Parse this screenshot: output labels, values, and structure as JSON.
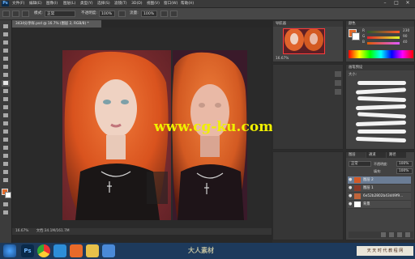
{
  "title_bar": {
    "app_logo": "Ps",
    "menu": [
      "文件(F)",
      "编辑(E)",
      "图像(I)",
      "图层(L)",
      "类型(Y)",
      "选择(S)",
      "滤镜(T)",
      "3D(D)",
      "视图(V)",
      "窗口(W)",
      "帮助(H)"
    ],
    "window_controls": {
      "minimize": "–",
      "maximize": "□",
      "close": "✕"
    }
  },
  "options_bar": {
    "mode_label": "模式:",
    "mode_value": "正常",
    "opacity_label": "不透明度:",
    "opacity_value": "100%",
    "flow_label": "流量:",
    "flow_value": "100%"
  },
  "document": {
    "tab_label": "3434分享样.psd @ 16.7% (图层 2, RGB/8) *",
    "watermark_text": "www.cg-ku.com",
    "status_zoom": "16.67%",
    "status_doc": "文档:34.1M/161.7M"
  },
  "navigator": {
    "zoom": "16.67%"
  },
  "color_panel": {
    "sliders": [
      {
        "label": "R",
        "value": "230"
      },
      {
        "label": "G",
        "value": "90"
      },
      {
        "label": "B",
        "value": "40"
      }
    ]
  },
  "brush_panel": {
    "tab_label": "画笔预设",
    "size_label": "大小:",
    "size_value": ""
  },
  "layers_panel": {
    "tabs": [
      "图层",
      "通道",
      "路径"
    ],
    "blend_mode": "正常",
    "opacity_label": "不透明度:",
    "opacity_value": "100%",
    "fill_label": "填充:",
    "fill_value": "100%",
    "layers": [
      {
        "name": "图层 2",
        "selected": true
      },
      {
        "name": "图层 1",
        "selected": false
      },
      {
        "name": "6e52b2802b43d49f9...",
        "selected": false
      },
      {
        "name": "背景",
        "selected": false
      }
    ]
  },
  "taskbar": {
    "icons": [
      "windows-start-icon",
      "ps-app-icon",
      "chrome-icon",
      "explorer-icon",
      "media-icon",
      "folder-icon",
      "mail-icon"
    ],
    "watermark_logo": "大人素材",
    "tray_text": "天 天 时 代 教 程 网"
  },
  "colors": {
    "accent": "#6b7d95",
    "watermark": "#f0f000",
    "hair": "#e0642c"
  }
}
